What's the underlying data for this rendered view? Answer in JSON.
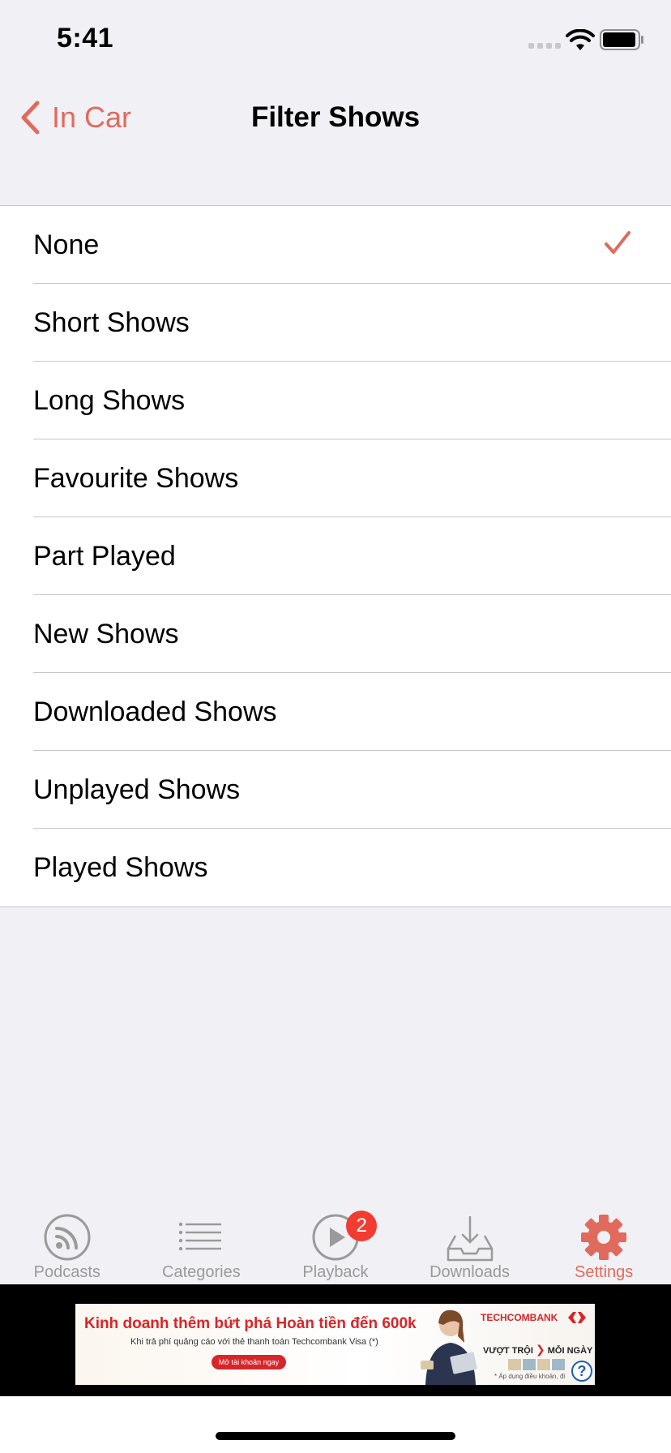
{
  "status_bar": {
    "time": "5:41"
  },
  "nav": {
    "back_label": "In Car",
    "title": "Filter Shows"
  },
  "filters": [
    {
      "label": "None",
      "selected": true
    },
    {
      "label": "Short Shows",
      "selected": false
    },
    {
      "label": "Long Shows",
      "selected": false
    },
    {
      "label": "Favourite Shows",
      "selected": false
    },
    {
      "label": "Part Played",
      "selected": false
    },
    {
      "label": "New Shows",
      "selected": false
    },
    {
      "label": "Downloaded Shows",
      "selected": false
    },
    {
      "label": "Unplayed Shows",
      "selected": false
    },
    {
      "label": "Played Shows",
      "selected": false
    }
  ],
  "tab_bar": {
    "tabs": [
      {
        "label": "Podcasts",
        "icon": "podcast-icon"
      },
      {
        "label": "Categories",
        "icon": "list-icon"
      },
      {
        "label": "Playback",
        "icon": "play-icon",
        "badge": "2"
      },
      {
        "label": "Downloads",
        "icon": "inbox-download-icon"
      },
      {
        "label": "Settings",
        "icon": "gear-icon",
        "active": true
      }
    ]
  },
  "ad": {
    "headline": "Kinh doanh thêm bứt phá Hoàn tiền đến 600k",
    "subtext": "Khi trả phí quảng cáo với thẻ thanh toán Techcombank Visa (*)",
    "cta": "Mở tài khoản ngay",
    "brand": "TECHCOMBANK",
    "slogan_left": "VƯỢT TRỘI",
    "slogan_right": "MỖI NGÀY",
    "note": "* Áp dụng điều khoản, đi",
    "help": "?"
  },
  "colors": {
    "accent": "#e06b5c",
    "background": "#f0f0f5",
    "badge": "#f23c32",
    "tab_inactive": "#9a9a9a",
    "ad_red": "#d7262a"
  }
}
